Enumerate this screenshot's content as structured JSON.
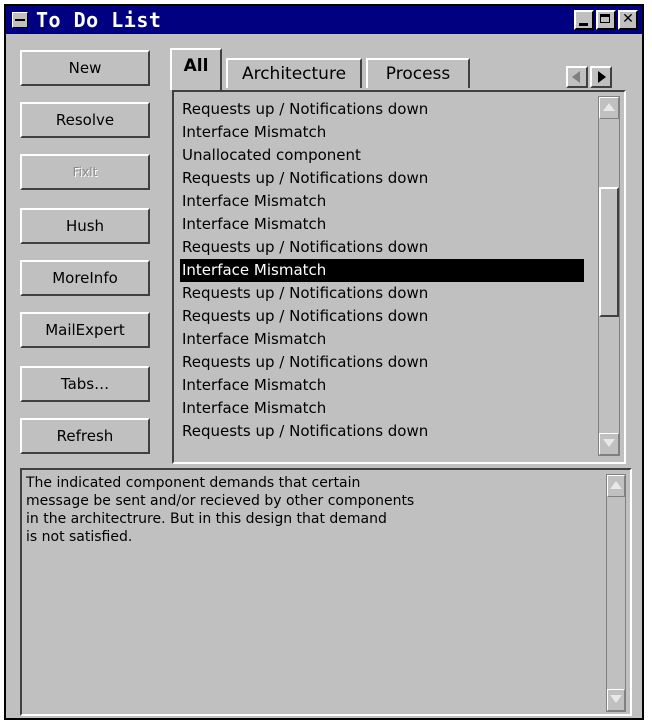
{
  "window": {
    "title": "To Do List",
    "icons": {
      "system_menu": "system-menu-icon",
      "minimize": "minimize-icon",
      "maximize": "maximize-icon",
      "close": "close-icon"
    }
  },
  "buttons": {
    "new": "New",
    "resolve": "Resolve",
    "fixit": "FixIt",
    "hush": "Hush",
    "moreinfo": "MoreInfo",
    "mailexpert": "MailExpert",
    "tabs": "Tabs…",
    "refresh": "Refresh"
  },
  "tabs": [
    "All",
    "Architecture",
    "Process"
  ],
  "active_tab": "All",
  "tab_nav_icons": [
    "scroll-left-icon",
    "scroll-right-icon"
  ],
  "todo_items": [
    "Requests up / Notifications down",
    "Interface Mismatch",
    "Unallocated component",
    "Requests up / Notifications down",
    "Interface Mismatch",
    "Interface Mismatch",
    "Requests up / Notifications down",
    "Interface Mismatch",
    "Requests up / Notifications down",
    "Requests up / Notifications down",
    "Interface Mismatch",
    "Requests up / Notifications down",
    "Interface Mismatch",
    "Interface Mismatch",
    "Requests up / Notifications down"
  ],
  "selected_index": 7,
  "detail": {
    "text": "The indicated component demands that certain\nmessage be sent and/or recieved by other components\nin the architectrure. But in this design that demand\nis not satisfied."
  },
  "colors": {
    "title_bar": "#000080",
    "face": "#c0c0c0",
    "selection": "#000000"
  }
}
